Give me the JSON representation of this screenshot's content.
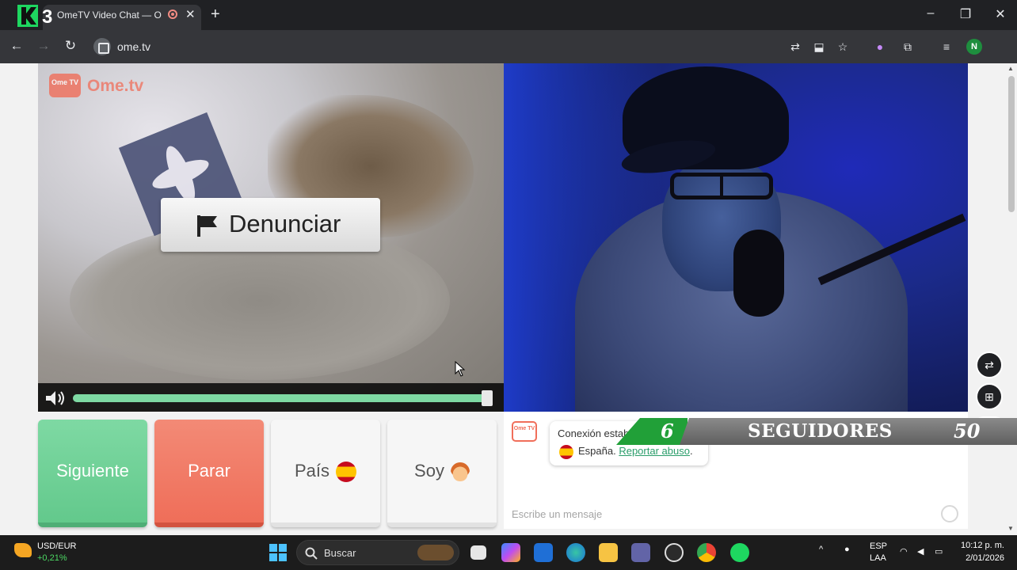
{
  "browser": {
    "tab_title": "OmeTV Video Chat — Ome",
    "tab_close": "✕",
    "new_tab": "+",
    "url": "ome.tv",
    "profile_initial": "N",
    "window": {
      "minimize": "–",
      "maximize": "❐",
      "close": "✕"
    }
  },
  "overlay_logo": {
    "badge": "3"
  },
  "page": {
    "brand_badge": "Ome TV",
    "brand_name": "Ome.tv",
    "report_label": "Denunciar",
    "volume": {
      "level_percent": 99
    },
    "buttons": {
      "next": "Siguiente",
      "stop": "Parar",
      "country": "País",
      "gender": "Soy"
    },
    "chat": {
      "avatar_label": "Ome TV",
      "line1": "Conexión establecida.",
      "country": "España.",
      "report_link": "Reportar abuso",
      "period": ".",
      "placeholder": "Escribe un mensaje"
    }
  },
  "followers_banner": {
    "current": "6",
    "label": "SEGUIDORES",
    "goal": "50"
  },
  "taskbar": {
    "ticker_label": "USD/EUR",
    "ticker_change": "+0,21%",
    "search_label": "Buscar",
    "language_line1": "ESP",
    "language_line2": "LAA",
    "time": "10:12 p. m.",
    "date": "2/01/2026"
  },
  "colors": {
    "next_green": "#63c98c",
    "stop_red": "#ef6e59",
    "brand_coral": "#f06e5a",
    "link_green": "#2a9d6a",
    "banner_green": "#21a038"
  }
}
